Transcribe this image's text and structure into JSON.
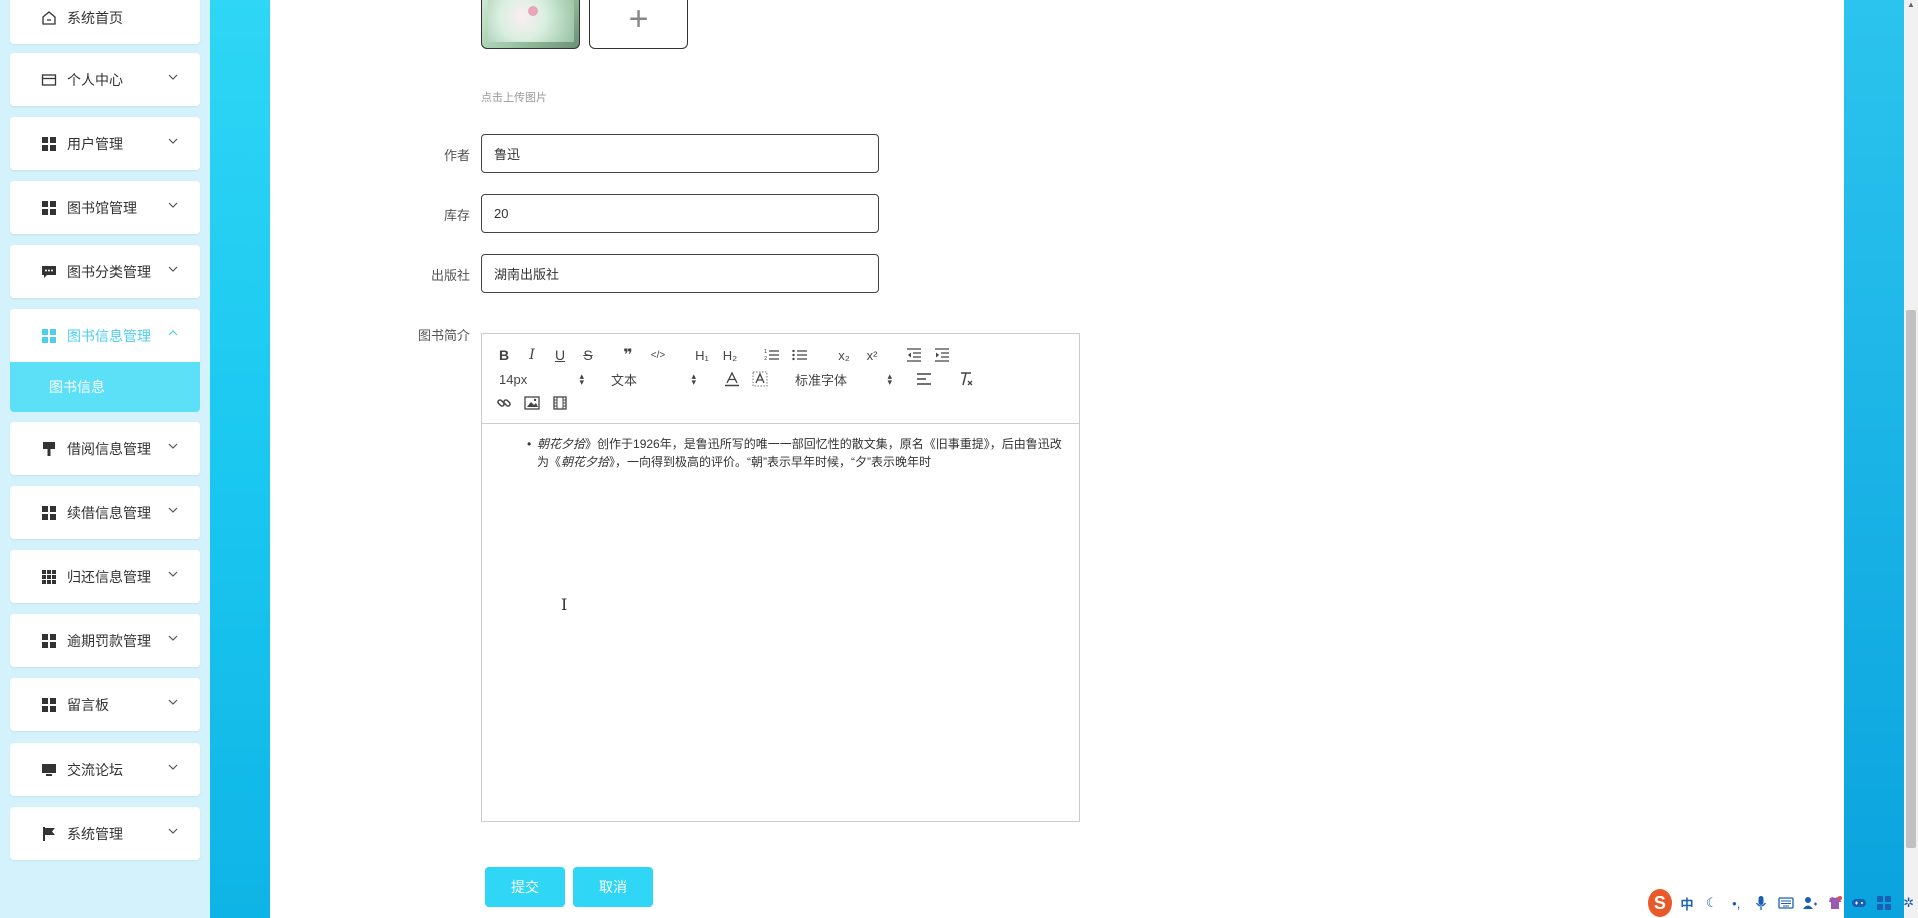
{
  "sidebar": {
    "items": [
      {
        "label": "系统首页",
        "icon": "home-icon"
      },
      {
        "label": "个人中心",
        "icon": "card-icon"
      },
      {
        "label": "用户管理",
        "icon": "grid-icon"
      },
      {
        "label": "图书馆管理",
        "icon": "grid-icon"
      },
      {
        "label": "图书分类管理",
        "icon": "chat-icon"
      },
      {
        "label": "图书信息管理",
        "icon": "grid-icon",
        "active": true
      },
      {
        "label": "借阅信息管理",
        "icon": "brush-icon"
      },
      {
        "label": "续借信息管理",
        "icon": "grid-icon"
      },
      {
        "label": "归还信息管理",
        "icon": "grid9-icon"
      },
      {
        "label": "逾期罚款管理",
        "icon": "grid-icon"
      },
      {
        "label": "留言板",
        "icon": "grid-icon"
      },
      {
        "label": "交流论坛",
        "icon": "monitor-icon"
      },
      {
        "label": "系统管理",
        "icon": "flag-icon"
      }
    ],
    "submenu": {
      "label": "图书信息"
    }
  },
  "form": {
    "upload_hint": "点击上传图片",
    "upload_plus": "+",
    "author": {
      "label": "作者",
      "value": "鲁迅"
    },
    "stock": {
      "label": "库存",
      "value": "20"
    },
    "publisher": {
      "label": "出版社",
      "value": "湖南出版社"
    },
    "intro_label": "图书简介"
  },
  "editor": {
    "toolbar": {
      "bold": "B",
      "italic": "I",
      "underline": "U",
      "strike": "S",
      "quote": "❞",
      "code": "</>",
      "h1": "H₁",
      "h2": "H₂",
      "sub": "x₂",
      "sup": "x²",
      "size": "14px",
      "format": "文本",
      "font": "标准字体"
    },
    "content": {
      "t1": "朝花夕拾",
      "t2": "》创作于1926年，是鲁迅所写的唯一一部回忆性的散文集，原名《旧事重提》，后由鲁迅改为《",
      "t3": "朝花夕拾",
      "t4": "》，一向得到极高的评价。“朝”表示早年时候，“夕”表示晚年时"
    }
  },
  "buttons": {
    "submit": "提交",
    "cancel": "取消"
  },
  "tray": {
    "ime": "中",
    "logo": "S"
  }
}
